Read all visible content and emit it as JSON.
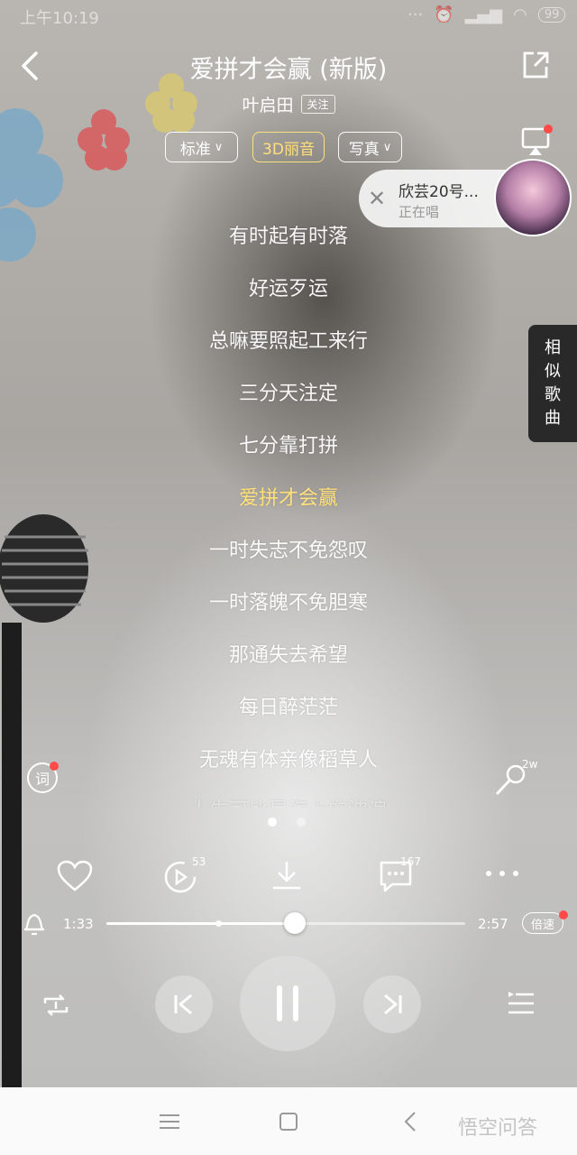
{
  "status_bar": {
    "time": "上午10:19",
    "battery": "99"
  },
  "header": {
    "title": "爱拼才会赢 (新版)",
    "artist": "叶启田",
    "follow_label": "关注",
    "quality_label": "标准",
    "effect_label": "3D丽音",
    "mode_label": "写真"
  },
  "singer_card": {
    "name": "欣芸20号...",
    "status": "正在唱"
  },
  "side_tab": {
    "chars": [
      "相",
      "似",
      "歌",
      "曲"
    ]
  },
  "lyrics": {
    "lines": [
      "有时起有时落",
      "好运歹运",
      "总嘛要照起工来行",
      "三分天注定",
      "七分靠打拼",
      "爱拼才会赢",
      "一时失志不免怨叹",
      "一时落魄不免胆寒",
      "那通失去希望",
      "每日醉茫茫",
      "无魂有体亲像稻草人",
      "人生可比是海上的波浪"
    ],
    "active_index": 5
  },
  "left_float": {
    "label": "词"
  },
  "right_float": {
    "count": "2w"
  },
  "actions": {
    "timer_count": "53",
    "comment_count": "167"
  },
  "player": {
    "elapsed": "1:33",
    "duration": "2:57",
    "progress": 0.525,
    "speed_label": "倍速"
  },
  "watermark": "悟空问答",
  "colors": {
    "active_lyric": "#ffe07a",
    "badge_red": "#ff4a4a"
  }
}
